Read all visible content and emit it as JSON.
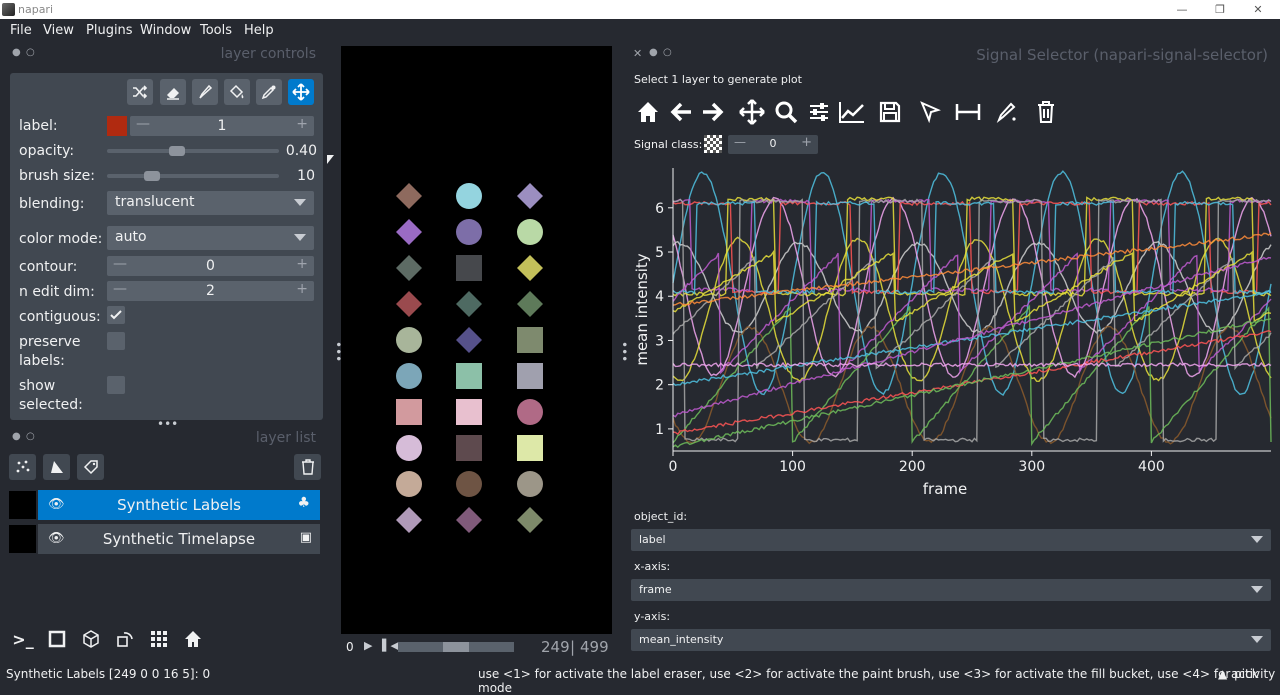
{
  "window": {
    "title": "napari"
  },
  "menu": [
    "File",
    "View",
    "Plugins",
    "Window",
    "Tools",
    "Help"
  ],
  "layer_controls": {
    "title": "layer controls",
    "rows": {
      "label": "label:",
      "label_value": "1",
      "opacity": "opacity:",
      "opacity_value": "0.40",
      "opacity_fraction": 0.4,
      "brush": "brush size:",
      "brush_value": "10",
      "brush_fraction": 0.24,
      "blending": "blending:",
      "blending_value": "translucent",
      "color_mode": "color mode:",
      "color_mode_value": "auto",
      "contour": "contour:",
      "contour_value": "0",
      "n_edit": "n edit dim:",
      "n_edit_value": "2",
      "contiguous": "contiguous:",
      "preserve": "preserve",
      "preserve2": "labels:",
      "show": "show",
      "show2": "selected:"
    },
    "label_color": "#b02a10"
  },
  "layer_list": {
    "title": "layer list",
    "layers": [
      {
        "name": "Synthetic Labels",
        "selected": true
      },
      {
        "name": "Synthetic Timelapse",
        "selected": false
      }
    ]
  },
  "dims": {
    "start": "0",
    "current": "249",
    "total": "499",
    "fraction": 0.5
  },
  "plugin": {
    "title": "Signal Selector (napari-signal-selector)",
    "instruction": "Select 1 layer to generate plot",
    "signal_class_label": "Signal class:",
    "signal_class_value": "0",
    "xlabel": "frame",
    "ylabel": "mean intensity",
    "x_ticks": [
      "0",
      "100",
      "200",
      "300",
      "400"
    ],
    "y_ticks": [
      "1",
      "2",
      "3",
      "4",
      "5",
      "6"
    ],
    "object_id_label": "object_id:",
    "object_id_value": "label",
    "x_axis_label": "x-axis:",
    "x_axis_value": "frame",
    "y_axis_label": "y-axis:",
    "y_axis_value": "mean_intensity"
  },
  "status": {
    "left": "Synthetic Labels [249 0 0 16 5]: 0",
    "help": "use <1> for activate the label eraser, use <2> for activate the paint brush, use <3> for activate the fill bucket, use <4> for pick mode",
    "activity": "▲ activity"
  },
  "chart_data": {
    "type": "line",
    "title": "",
    "xlabel": "frame",
    "ylabel": "mean intensity",
    "xlim": [
      0,
      500
    ],
    "ylim": [
      0.5,
      6.9
    ],
    "series": [
      {
        "kind": "sine",
        "color": "#4fc1e0",
        "offset": 4.3,
        "amp": 2.5,
        "period": 100,
        "phase": 0
      },
      {
        "kind": "sine",
        "color": "#f2a6f0",
        "offset": 4.2,
        "amp": 2.0,
        "period": 100,
        "phase": 40
      },
      {
        "kind": "sine",
        "color": "#d0d0d0",
        "offset": 4.2,
        "amp": 1.0,
        "period": 100,
        "phase": 20
      },
      {
        "kind": "sine",
        "color": "#8b5a2b",
        "offset": 2.0,
        "amp": 1.3,
        "period": 100,
        "phase": 60
      },
      {
        "kind": "sine",
        "color": "#e8e03a",
        "offset": 3.7,
        "amp": 1.6,
        "period": 100,
        "phase": 70
      },
      {
        "kind": "square",
        "color": "#ff5555",
        "low": 4.1,
        "high": 6.1,
        "period": 100,
        "duty": 0.6,
        "phase": 10
      },
      {
        "kind": "square",
        "color": "#c05ad0",
        "low": 4.15,
        "high": 6.15,
        "period": 100,
        "duty": 0.5,
        "phase": 35
      },
      {
        "kind": "square",
        "color": "#e8e03a",
        "low": 4.05,
        "high": 6.2,
        "period": 100,
        "duty": 0.4,
        "phase": 55
      },
      {
        "kind": "square",
        "color": "#a8a8a8",
        "low": 0.75,
        "high": 6.15,
        "period": 100,
        "duty": 0.55,
        "phase": 45
      },
      {
        "kind": "square",
        "color": "#4fc1e0",
        "low": 4.1,
        "high": 6.1,
        "period": 100,
        "duty": 0.5,
        "phase": 80
      },
      {
        "kind": "saw",
        "color": "#6ebd5a",
        "low": 0.7,
        "high": 3.8,
        "period": 100,
        "phase": 0
      },
      {
        "kind": "saw",
        "color": "#a8a8a8",
        "low": 2.4,
        "high": 4.9,
        "period": 100,
        "phase": 30
      },
      {
        "kind": "saw",
        "color": "#c05ad0",
        "low": 2.3,
        "high": 5.0,
        "period": 100,
        "phase": 60
      },
      {
        "kind": "saw",
        "color": "#e8e03a",
        "low": 3.4,
        "high": 5.0,
        "period": 100,
        "phase": 15
      },
      {
        "kind": "ramp",
        "color": "#ff5555",
        "start": 0.9,
        "end": 3.2
      },
      {
        "kind": "ramp",
        "color": "#6ebd5a",
        "start": 0.6,
        "end": 3.5
      },
      {
        "kind": "ramp",
        "color": "#4fc1e0",
        "start": 2.0,
        "end": 4.1
      },
      {
        "kind": "ramp",
        "color": "#c05ad0",
        "start": 1.3,
        "end": 4.9
      },
      {
        "kind": "ramp",
        "color": "#ff8c3a",
        "start": 3.8,
        "end": 5.4
      },
      {
        "kind": "flat",
        "color": "#f2a6f0",
        "value": 2.45
      }
    ]
  },
  "canvas_shapes": [
    {
      "col": 0,
      "row": 0,
      "shape": "diamond",
      "color": "#8e6a5e"
    },
    {
      "col": 1,
      "row": 0,
      "shape": "circle",
      "color": "#94d4df"
    },
    {
      "col": 2,
      "row": 0,
      "shape": "diamond",
      "color": "#9b8ec0"
    },
    {
      "col": 0,
      "row": 1,
      "shape": "diamond",
      "color": "#9a6bc4"
    },
    {
      "col": 1,
      "row": 1,
      "shape": "circle",
      "color": "#7d6ea8"
    },
    {
      "col": 2,
      "row": 1,
      "shape": "circle",
      "color": "#b9d9a6"
    },
    {
      "col": 0,
      "row": 2,
      "shape": "diamond",
      "color": "#5d6b64"
    },
    {
      "col": 1,
      "row": 2,
      "shape": "square",
      "color": "#46484c"
    },
    {
      "col": 2,
      "row": 2,
      "shape": "diamond",
      "color": "#c3c05a"
    },
    {
      "col": 0,
      "row": 3,
      "shape": "diamond",
      "color": "#9a4a4e"
    },
    {
      "col": 1,
      "row": 3,
      "shape": "diamond",
      "color": "#4e6a62"
    },
    {
      "col": 2,
      "row": 3,
      "shape": "diamond",
      "color": "#5e7a5a"
    },
    {
      "col": 0,
      "row": 4,
      "shape": "circle",
      "color": "#a8b59a"
    },
    {
      "col": 1,
      "row": 4,
      "shape": "diamond",
      "color": "#56518a"
    },
    {
      "col": 2,
      "row": 4,
      "shape": "square",
      "color": "#7e8a6e"
    },
    {
      "col": 0,
      "row": 5,
      "shape": "circle",
      "color": "#7ca6b8"
    },
    {
      "col": 1,
      "row": 5,
      "shape": "square",
      "color": "#8cc0a8"
    },
    {
      "col": 2,
      "row": 5,
      "shape": "square",
      "color": "#a0a0ae"
    },
    {
      "col": 0,
      "row": 6,
      "shape": "square",
      "color": "#d29a9e"
    },
    {
      "col": 1,
      "row": 6,
      "shape": "square",
      "color": "#e8c0cf"
    },
    {
      "col": 2,
      "row": 6,
      "shape": "circle",
      "color": "#b06a86"
    },
    {
      "col": 0,
      "row": 7,
      "shape": "circle",
      "color": "#d6bcd8"
    },
    {
      "col": 1,
      "row": 7,
      "shape": "square",
      "color": "#5e4a4e"
    },
    {
      "col": 2,
      "row": 7,
      "shape": "square",
      "color": "#dde8a8"
    },
    {
      "col": 0,
      "row": 8,
      "shape": "circle",
      "color": "#c4aa98"
    },
    {
      "col": 1,
      "row": 8,
      "shape": "circle",
      "color": "#6e5444"
    },
    {
      "col": 2,
      "row": 8,
      "shape": "circle",
      "color": "#9c9688"
    },
    {
      "col": 0,
      "row": 9,
      "shape": "diamond",
      "color": "#b09ab8"
    },
    {
      "col": 1,
      "row": 9,
      "shape": "diamond",
      "color": "#805a7a"
    },
    {
      "col": 2,
      "row": 9,
      "shape": "diamond",
      "color": "#7e8a6a"
    }
  ]
}
